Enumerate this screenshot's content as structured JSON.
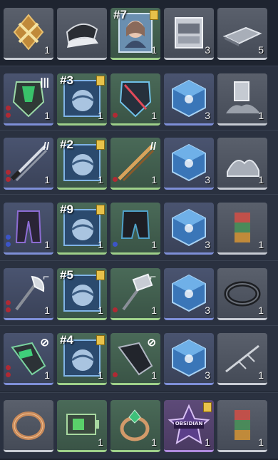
{
  "rows": [
    {
      "cells": [
        {
          "icon": "gold-crystal-icon",
          "count": "1",
          "rarity": "grey"
        },
        {
          "icon": "cap-icon",
          "count": "",
          "rarity": "grey"
        },
        {
          "icon": "portrait-icon",
          "count": "1",
          "tag": "#7",
          "rarity": "green"
        },
        {
          "icon": "crate-icon",
          "count": "3",
          "rarity": "grey"
        },
        {
          "icon": "plate-icon",
          "count": "5",
          "rarity": "grey"
        }
      ]
    },
    {
      "cells": [
        {
          "icon": "chest-armor-green-icon",
          "count": "1",
          "rarity": "blue"
        },
        {
          "icon": "blueprint-card-icon",
          "count": "1",
          "tag": "#3",
          "rarity": "green"
        },
        {
          "icon": "chest-armor-blue-icon",
          "count": "1",
          "rarity": "green"
        },
        {
          "icon": "cube-icon",
          "count": "3",
          "rarity": "blue"
        },
        {
          "icon": "scrap-pile-icon",
          "count": "1",
          "rarity": "grey"
        }
      ]
    },
    {
      "cells": [
        {
          "icon": "dual-blade-icon",
          "count": "1",
          "rarity": "blue"
        },
        {
          "icon": "blueprint-card-icon",
          "count": "1",
          "tag": "#2",
          "rarity": "green"
        },
        {
          "icon": "gold-blade-icon",
          "count": "1",
          "rarity": "green"
        },
        {
          "icon": "cube-icon",
          "count": "3",
          "rarity": "blue"
        },
        {
          "icon": "scrap-pile-icon",
          "count": "1",
          "rarity": "grey"
        }
      ]
    },
    {
      "cells": [
        {
          "icon": "leggings-icon",
          "count": "1",
          "rarity": "blue"
        },
        {
          "icon": "blueprint-card-icon",
          "count": "1",
          "tag": "#9",
          "rarity": "green"
        },
        {
          "icon": "shorts-icon",
          "count": "1",
          "rarity": "green"
        },
        {
          "icon": "cube-icon",
          "count": "3",
          "rarity": "blue"
        },
        {
          "icon": "book-stack-icon",
          "count": "1",
          "rarity": "grey"
        }
      ]
    },
    {
      "cells": [
        {
          "icon": "axe-icon",
          "count": "1",
          "rarity": "blue"
        },
        {
          "icon": "blueprint-card-icon",
          "count": "1",
          "tag": "#5",
          "rarity": "green"
        },
        {
          "icon": "hammer-axe-icon",
          "count": "1",
          "rarity": "green"
        },
        {
          "icon": "cube-icon",
          "count": "3",
          "rarity": "blue"
        },
        {
          "icon": "ring-coil-icon",
          "count": "1",
          "rarity": "grey"
        }
      ]
    },
    {
      "cells": [
        {
          "icon": "gauntlet-green-icon",
          "count": "1",
          "rarity": "blue"
        },
        {
          "icon": "blueprint-card-icon",
          "count": "1",
          "tag": "#4",
          "rarity": "green"
        },
        {
          "icon": "gauntlet-dark-icon",
          "count": "1",
          "rarity": "green"
        },
        {
          "icon": "cube-icon",
          "count": "3",
          "rarity": "blue"
        },
        {
          "icon": "twig-icon",
          "count": "1",
          "rarity": "grey"
        }
      ]
    },
    {
      "cells": [
        {
          "icon": "copper-ring-icon",
          "count": "",
          "rarity": "grey"
        },
        {
          "icon": "green-battery-icon",
          "count": "1",
          "rarity": "green"
        },
        {
          "icon": "green-gem-ring-icon",
          "count": "1",
          "rarity": "green"
        },
        {
          "icon": "obsidian-emblem-icon",
          "count": "1",
          "rarity": "purple",
          "emblem_text": "OBSIDIAN"
        },
        {
          "icon": "book-stack-icon",
          "count": "1",
          "rarity": "grey"
        }
      ]
    }
  ]
}
